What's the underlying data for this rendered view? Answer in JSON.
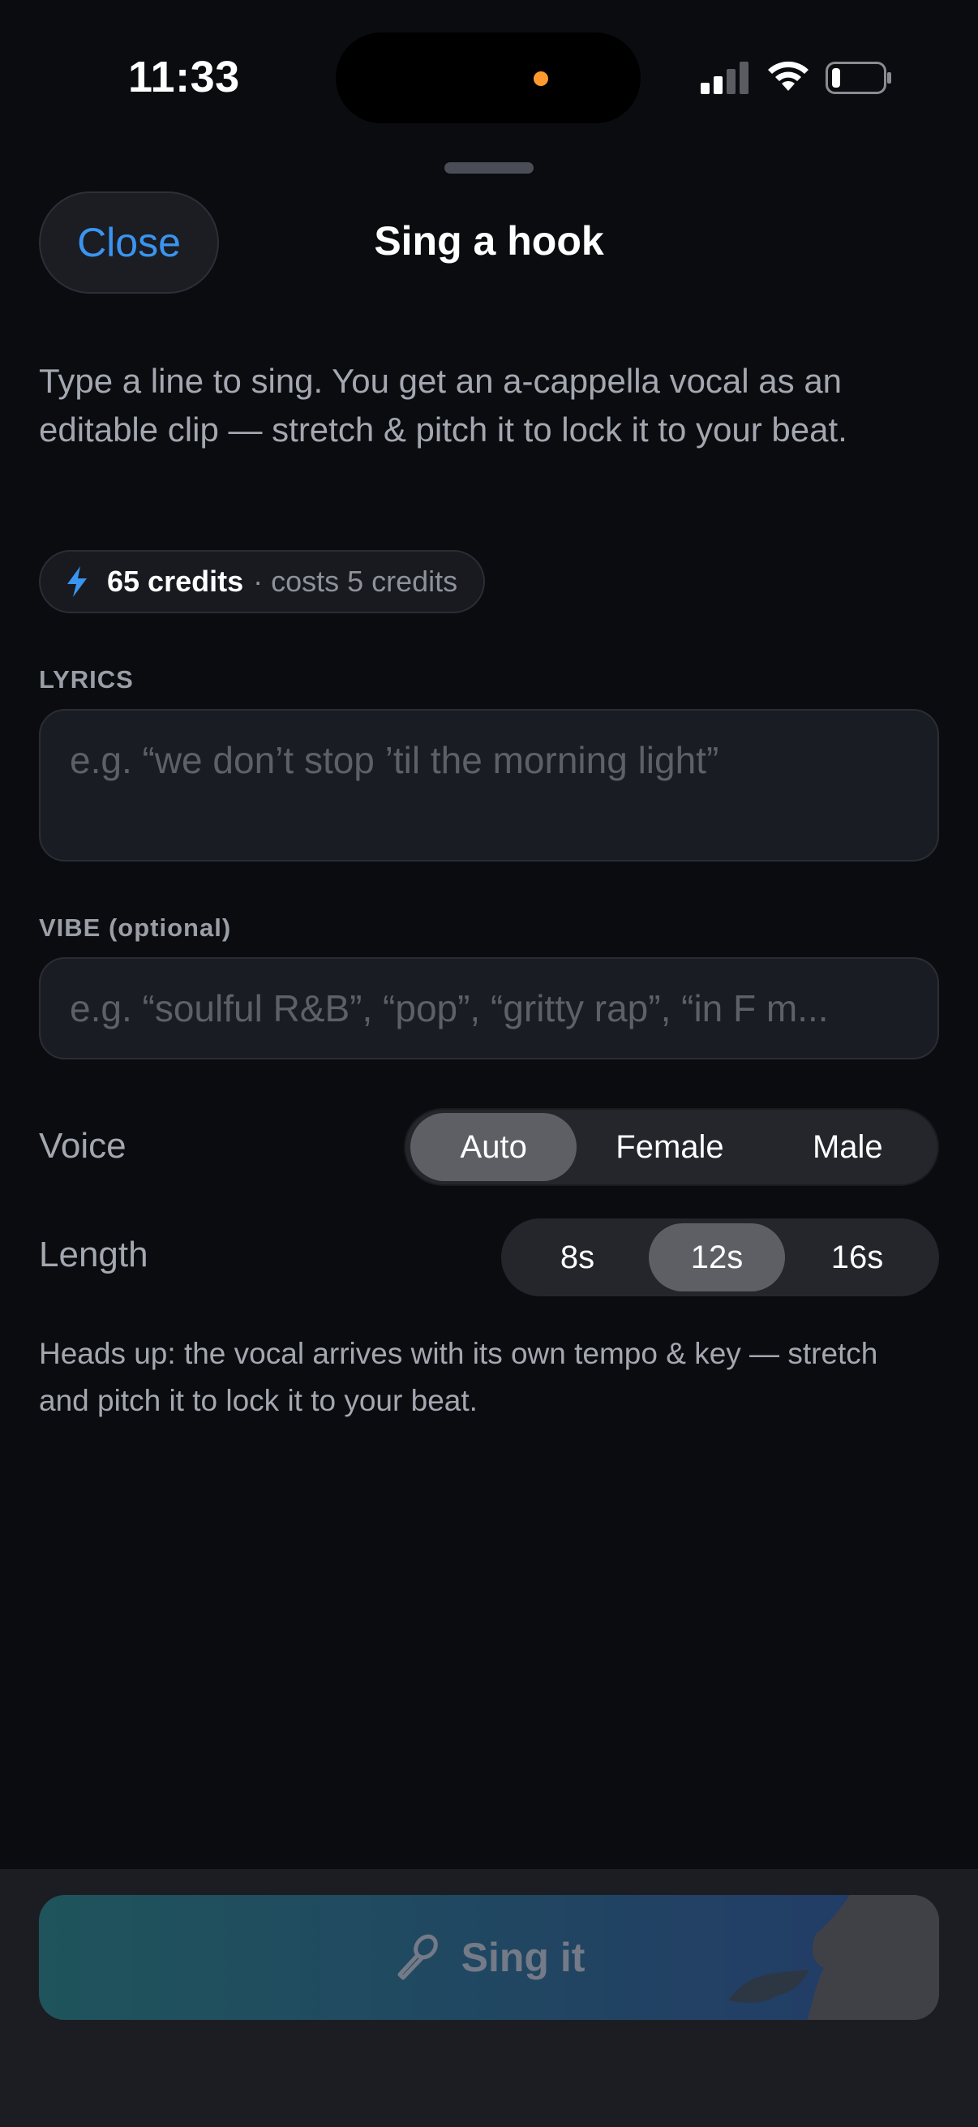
{
  "status_bar": {
    "time": "11:33"
  },
  "header": {
    "close_label": "Close",
    "title": "Sing a hook"
  },
  "description": "Type a line to sing. You get an a-cappella vocal as an editable clip — stretch & pitch it to lock it to your beat.",
  "credits": {
    "balance": "65 credits",
    "cost": "· costs 5 credits",
    "accent_color": "#3a94f0"
  },
  "lyrics": {
    "label": "LYRICS",
    "placeholder": "e.g. “we don’t stop ’til the morning light”"
  },
  "vibe": {
    "label": "VIBE (optional)",
    "placeholder": "e.g. “soulful R&B”, “pop”, “gritty rap”, “in F m..."
  },
  "voice": {
    "label": "Voice",
    "options": [
      "Auto",
      "Female",
      "Male"
    ],
    "selected": "Auto"
  },
  "length": {
    "label": "Length",
    "options": [
      "8s",
      "12s",
      "16s"
    ],
    "selected": "12s"
  },
  "note": "Heads up: the vocal arrives with its own tempo & key — stretch and pitch it to lock it to your beat.",
  "action": {
    "label": "Sing it",
    "icon": "microphone-icon"
  }
}
